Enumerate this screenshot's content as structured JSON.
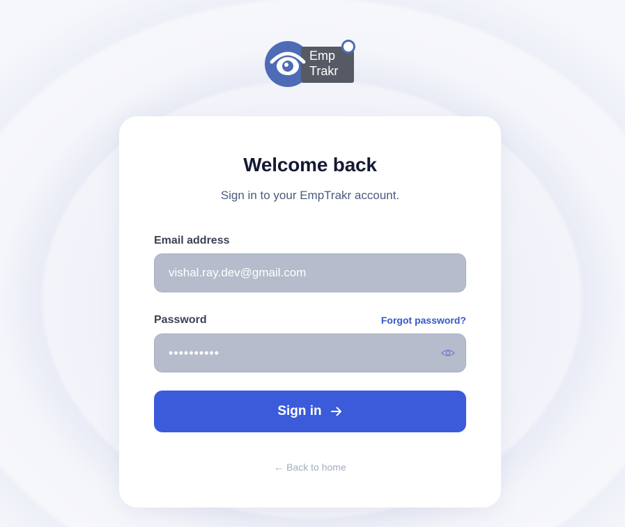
{
  "brand": {
    "logo_line1": "Emp",
    "logo_line2": "Trakr",
    "primary_color": "#4e6cb5",
    "tag_color": "#555a64"
  },
  "login": {
    "title": "Welcome back",
    "subtitle": "Sign in to your EmpTrakr account.",
    "email_label": "Email address",
    "email_value": "vishal.ray.dev@gmail.com",
    "password_label": "Password",
    "password_value": "••••••••••",
    "forgot_label": "Forgot password?",
    "submit_label": "Sign in",
    "submit_icon": "arrow-right-icon",
    "back_label": "← Back to home",
    "accent_color": "#3b5bdb"
  }
}
